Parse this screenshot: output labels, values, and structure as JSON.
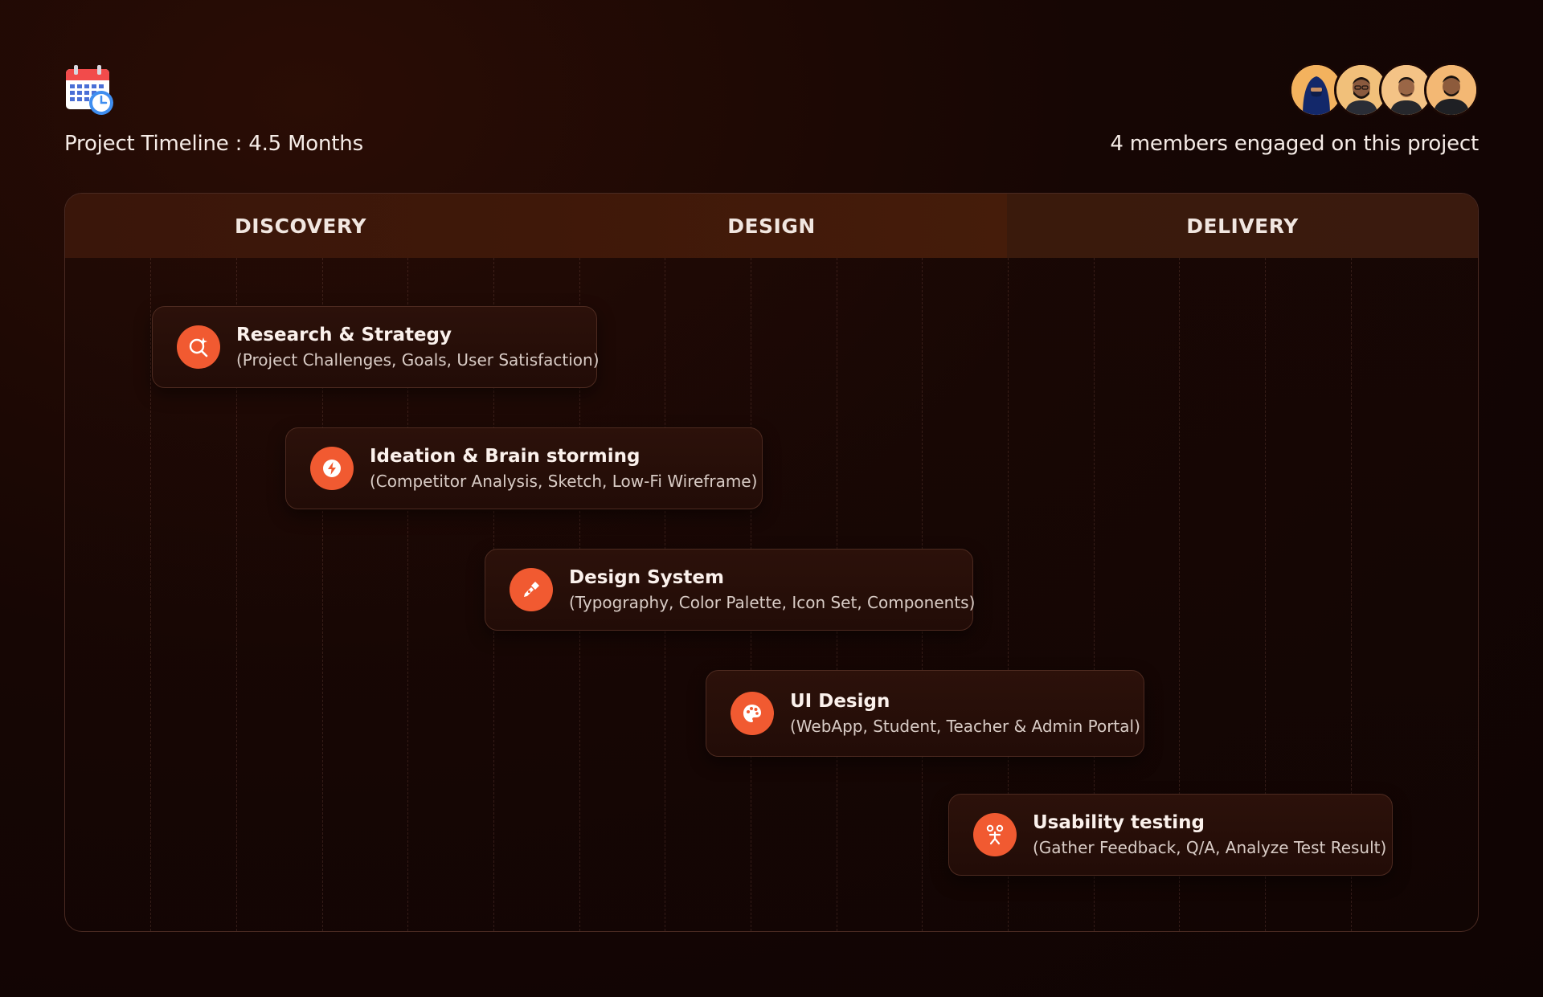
{
  "header": {
    "timeline_title": "Project Timeline : 4.5 Months",
    "members_text": "4 members engaged on this project",
    "calendar_icon": "calendar-clock-icon",
    "avatars": [
      "member-1",
      "member-2",
      "member-3",
      "member-4"
    ]
  },
  "phases": [
    {
      "label": "DISCOVERY"
    },
    {
      "label": "DESIGN"
    },
    {
      "label": "DELIVERY"
    }
  ],
  "tasks": [
    {
      "title": "Research & Strategy",
      "subtitle": "(Project Challenges, Goals, User Satisfaction)",
      "icon": "search-sparkle-icon"
    },
    {
      "title": "Ideation & Brain storming",
      "subtitle": "(Competitor Analysis, Sketch, Low-Fi Wireframe)",
      "icon": "bolt-icon"
    },
    {
      "title": "Design System",
      "subtitle": "(Typography, Color Palette, Icon Set, Components)",
      "icon": "pen-tool-icon"
    },
    {
      "title": "UI Design",
      "subtitle": "(WebApp, Student, Teacher & Admin Portal)",
      "icon": "palette-icon"
    },
    {
      "title": "Usability testing",
      "subtitle": "(Gather Feedback, Q/A, Analyze Test Result)",
      "icon": "usability-icon"
    }
  ],
  "colors": {
    "accent": "#f15a31",
    "background": "#140504",
    "card_border": "#4d2a20"
  }
}
